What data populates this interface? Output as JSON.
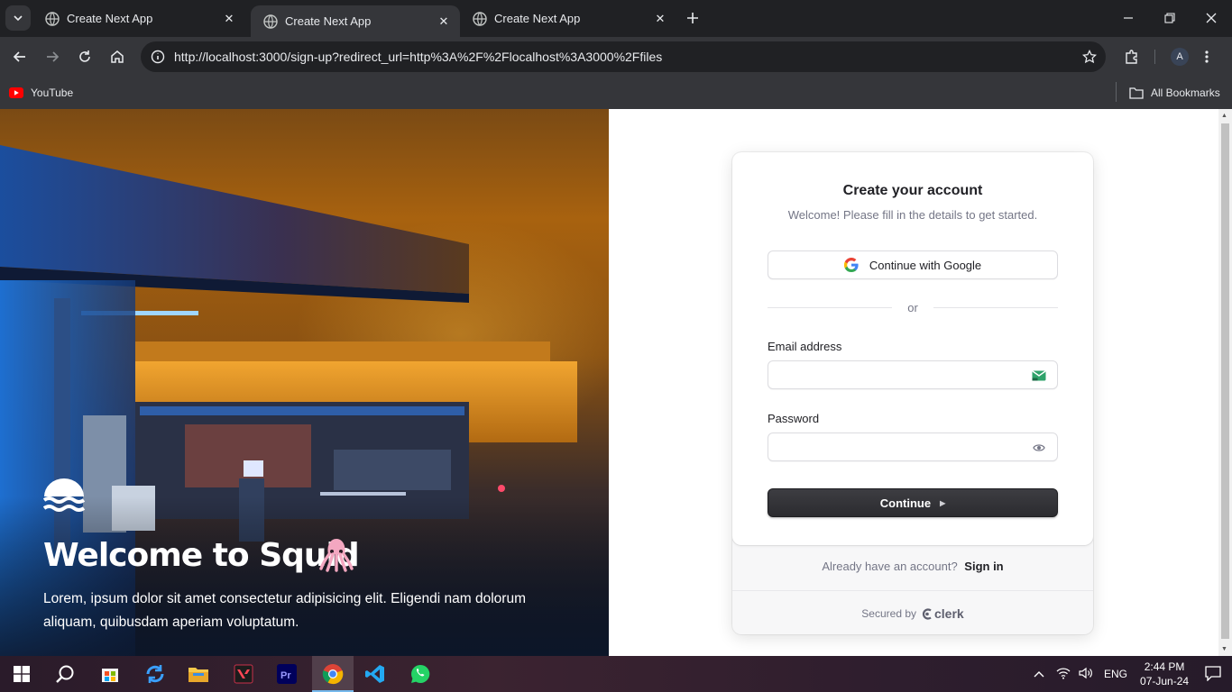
{
  "browser": {
    "tabs": [
      {
        "title": "Create Next App",
        "active": false
      },
      {
        "title": "Create Next App",
        "active": true
      },
      {
        "title": "Create Next App",
        "active": false
      }
    ],
    "url": "http://localhost:3000/sign-up?redirect_url=http%3A%2F%2Flocalhost%3A3000%2Ffiles",
    "profile_initial": "A",
    "bookmarks": [
      {
        "label": "YouTube",
        "icon": "youtube-icon"
      }
    ],
    "all_bookmarks_label": "All Bookmarks"
  },
  "hero": {
    "title": "Welcome to Squid",
    "emoji": "squid-icon",
    "text": "Lorem, ipsum dolor sit amet consectetur adipisicing elit. Eligendi nam dolorum aliquam, quibusdam aperiam voluptatum."
  },
  "signup": {
    "title": "Create your account",
    "subtitle": "Welcome! Please fill in the details to get started.",
    "google_label": "Continue with Google",
    "divider": "or",
    "email_label": "Email address",
    "email_value": "",
    "password_label": "Password",
    "password_value": "",
    "continue_label": "Continue",
    "footer_prompt": "Already have an account?",
    "signin_link": "Sign in",
    "secured_by": "Secured by",
    "brand": "clerk"
  },
  "taskbar": {
    "apps": [
      "start-icon",
      "search-icon",
      "store-icon",
      "sync-icon",
      "file-explorer-icon",
      "valorant-icon",
      "premiere-icon",
      "chrome-icon",
      "vscode-icon",
      "whatsapp-icon"
    ],
    "lang": "ENG",
    "time": "2:44 PM",
    "date": "07-Jun-24"
  },
  "colors": {
    "chrome_dark": "#202124",
    "chrome_toolbar": "#35363a",
    "button_dark": "#2f2f33",
    "muted_text": "#747686"
  }
}
